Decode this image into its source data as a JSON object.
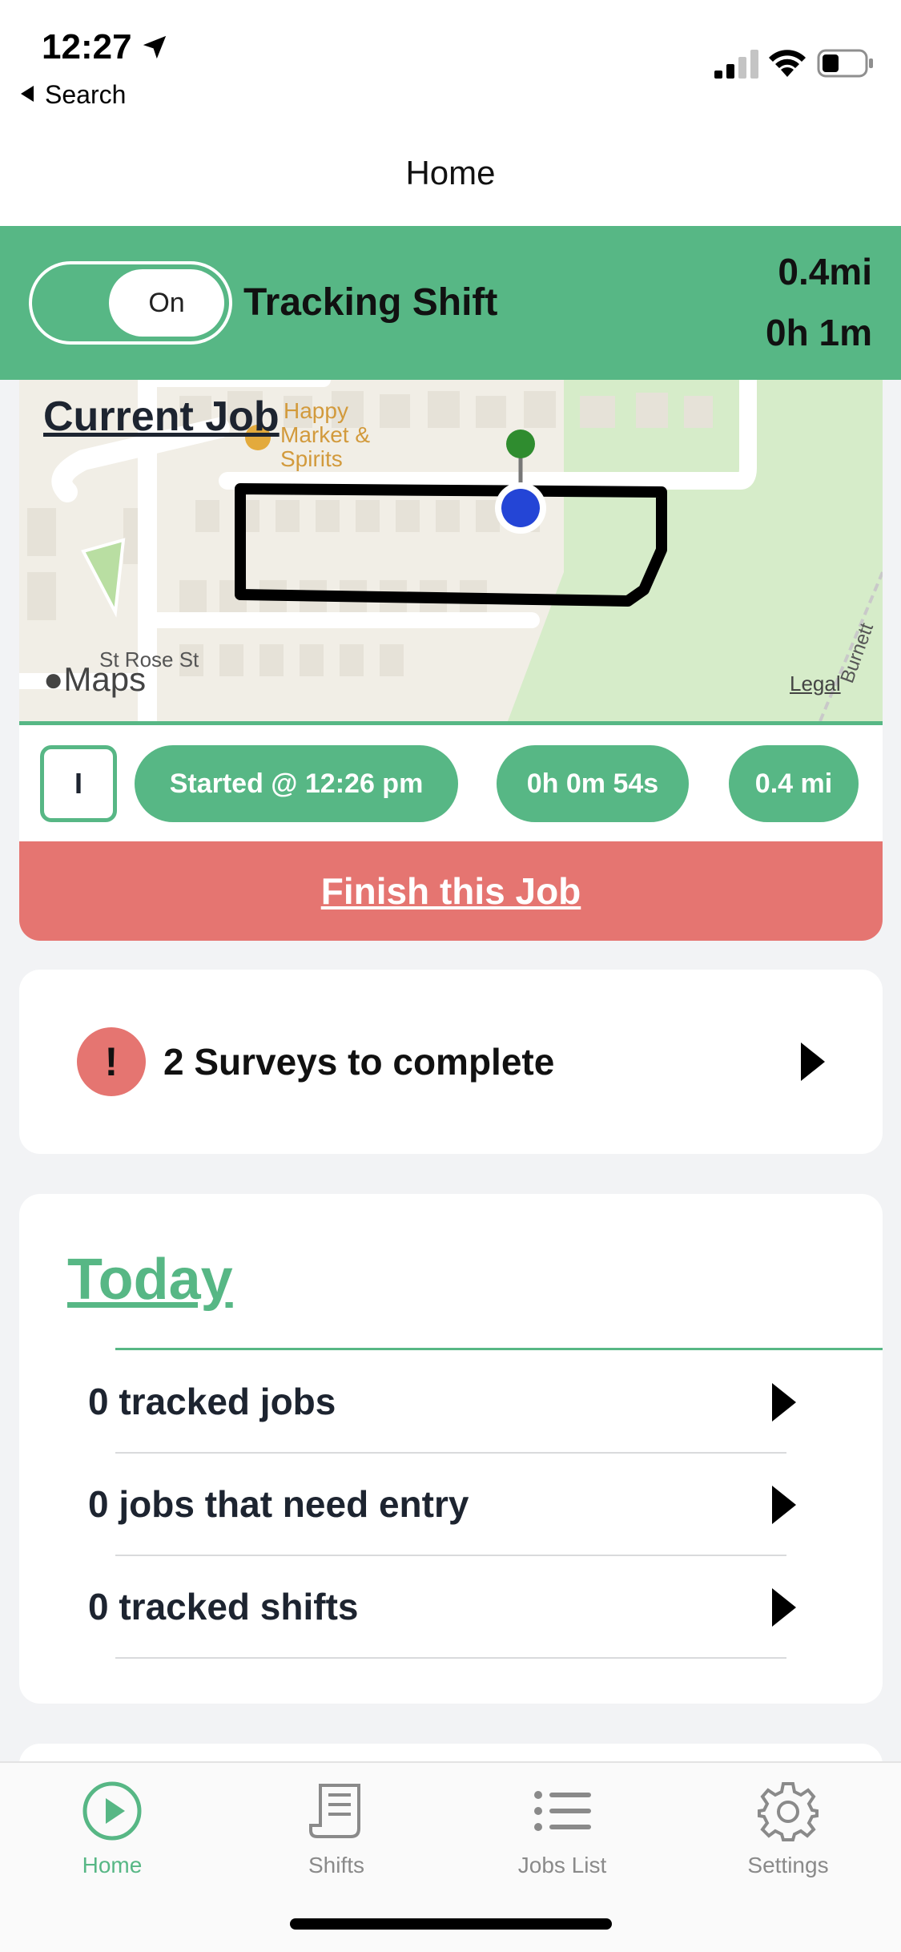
{
  "status_bar": {
    "time": "12:27",
    "back_label": "Search"
  },
  "nav": {
    "title": "Home"
  },
  "banner": {
    "toggle_label": "On",
    "title": "Tracking Shift",
    "distance": "0.4mi",
    "duration": "0h 1m",
    "color": "#57b785"
  },
  "current_job": {
    "heading": "Current Job",
    "map_labels": {
      "poi_1": "Happy",
      "poi_2": "Market &",
      "poi_3": "Spirits",
      "street_1": "St Rose St",
      "street_2": "Burnett",
      "maps_brand": "Maps",
      "legal": "Legal"
    },
    "mode_chip": "I",
    "started": "Started @ 12:26 pm",
    "elapsed": "0h 0m 54s",
    "distance": "0.4 mi",
    "finish_label": "Finish this Job",
    "finish_color": "#e57571"
  },
  "surveys": {
    "alert_symbol": "!",
    "text": "2 Surveys to complete"
  },
  "today": {
    "title": "Today",
    "rows": [
      {
        "label": "0 tracked jobs"
      },
      {
        "label": "0 jobs that need entry"
      },
      {
        "label": "0 tracked shifts"
      }
    ]
  },
  "tabs": [
    {
      "label": "Home",
      "icon": "play-circle-icon",
      "active": true
    },
    {
      "label": "Shifts",
      "icon": "receipt-icon",
      "active": false
    },
    {
      "label": "Jobs List",
      "icon": "list-icon",
      "active": false
    },
    {
      "label": "Settings",
      "icon": "gear-icon",
      "active": false
    }
  ]
}
